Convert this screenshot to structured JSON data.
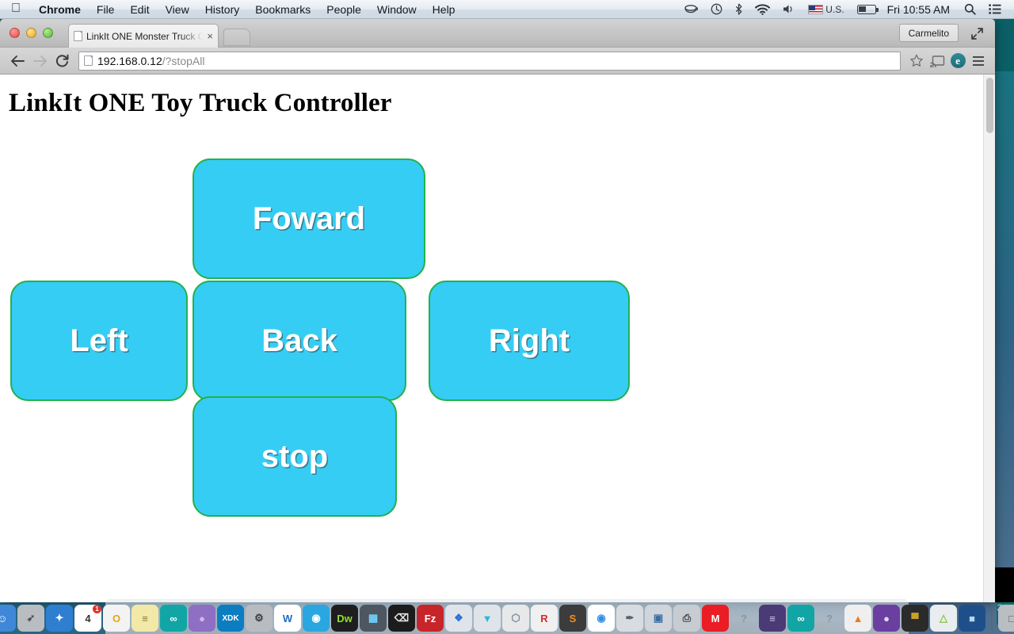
{
  "menubar": {
    "apple_icon": "apple-logo-icon",
    "items": [
      {
        "label": "Chrome",
        "bold": true
      },
      {
        "label": "File"
      },
      {
        "label": "Edit"
      },
      {
        "label": "View"
      },
      {
        "label": "History"
      },
      {
        "label": "Bookmarks"
      },
      {
        "label": "People"
      },
      {
        "label": "Window"
      },
      {
        "label": "Help"
      }
    ],
    "status": {
      "coffee_icon": "coffee-cup-icon",
      "timemachine_icon": "time-machine-icon",
      "bluetooth_icon": "bluetooth-icon",
      "wifi_icon": "wifi-icon",
      "volume_icon": "volume-icon",
      "input_source": "U.S.",
      "battery_icon": "battery-icon",
      "clock": "Fri 10:55 AM",
      "search_icon": "spotlight-search-icon",
      "notification_icon": "notification-center-icon"
    }
  },
  "window": {
    "tab": {
      "title": "LinkIt ONE Monster Truck C",
      "favicon": "page-icon",
      "close_label": "×"
    },
    "new_tab_label": "",
    "profile_label": "Carmelito",
    "fullscreen_icon": "fullscreen-arrows-icon"
  },
  "toolbar": {
    "back_icon": "back-arrow-icon",
    "forward_icon": "forward-arrow-icon",
    "reload_icon": "reload-icon",
    "url_host": "192.168.0.12",
    "url_path": "/?stopAll",
    "bookmark_icon": "star-icon",
    "cast_icon": "cast-icon",
    "extension_icon": "extension-e-icon",
    "extension_letter": "e",
    "menu_icon": "hamburger-menu-icon"
  },
  "page": {
    "heading": "LinkIt ONE Toy Truck Controller",
    "accent_fill": "#35cdf4",
    "accent_border": "#22b14c",
    "buttons": [
      {
        "id": "forward",
        "label": "Foward"
      },
      {
        "id": "left",
        "label": "Left"
      },
      {
        "id": "back",
        "label": "Back"
      },
      {
        "id": "right",
        "label": "Right"
      },
      {
        "id": "stop",
        "label": "stop"
      }
    ]
  },
  "dock": {
    "items": [
      {
        "name": "finder",
        "glyph": "☺",
        "bg": "#3f87d8",
        "fg": "#ffffff"
      },
      {
        "name": "launchpad",
        "glyph": "➶",
        "bg": "#b9bdc2",
        "fg": "#4a4f55"
      },
      {
        "name": "safari",
        "glyph": "✦",
        "bg": "#2f7fd0",
        "fg": "#ffffff"
      },
      {
        "name": "calendar",
        "glyph": "4",
        "bg": "#ffffff",
        "fg": "#333333",
        "badge": "1"
      },
      {
        "name": "office",
        "glyph": "O",
        "bg": "#f3f3f3",
        "fg": "#e8a317"
      },
      {
        "name": "stickies",
        "glyph": "≡",
        "bg": "#f2e8a8",
        "fg": "#8a7a35"
      },
      {
        "name": "arduino",
        "glyph": "∞",
        "bg": "#12a5a5",
        "fg": "#ffffff"
      },
      {
        "name": "purple-sphere",
        "glyph": "●",
        "bg": "#8e6fc4",
        "fg": "#cdb8ea"
      },
      {
        "name": "intel-xdk",
        "glyph": "XDK",
        "bg": "#0d7dc1",
        "fg": "#ffffff"
      },
      {
        "name": "system-preferences",
        "glyph": "⚙",
        "bg": "#b8bcc0",
        "fg": "#3b3f44"
      },
      {
        "name": "word",
        "glyph": "W",
        "bg": "#ffffff",
        "fg": "#1a6fc4"
      },
      {
        "name": "teal-app",
        "glyph": "◉",
        "bg": "#2aa7e0",
        "fg": "#ffffff"
      },
      {
        "name": "dreamweaver",
        "glyph": "Dw",
        "bg": "#1e1e1e",
        "fg": "#8fe02a"
      },
      {
        "name": "grabpro",
        "glyph": "▦",
        "bg": "#4e5661",
        "fg": "#6fd3ff"
      },
      {
        "name": "terminal",
        "glyph": "⌫",
        "bg": "#1c1c1c",
        "fg": "#e6e6e6"
      },
      {
        "name": "filezilla",
        "glyph": "Fz",
        "bg": "#c7252a",
        "fg": "#ffffff"
      },
      {
        "name": "blue-blocks",
        "glyph": "❖",
        "bg": "#dfe4ea",
        "fg": "#2b6fd0"
      },
      {
        "name": "teal-triangle",
        "glyph": "▼",
        "bg": "#dfe4ea",
        "fg": "#2ab9d9"
      },
      {
        "name": "3d-cube",
        "glyph": "⬡",
        "bg": "#e6e8ea",
        "fg": "#7d8a99"
      },
      {
        "name": "r-app",
        "glyph": "R",
        "bg": "#f0f0f0",
        "fg": "#d22b2b"
      },
      {
        "name": "sublime-text",
        "glyph": "S",
        "bg": "#3c3c3c",
        "fg": "#f09020"
      },
      {
        "name": "google-chrome",
        "glyph": "◉",
        "bg": "#ffffff",
        "fg": "#2f8de4"
      },
      {
        "name": "satellite",
        "glyph": "✒",
        "bg": "#d8dce0",
        "fg": "#55606b"
      },
      {
        "name": "remote-desktop",
        "glyph": "▣",
        "bg": "#cfd5da",
        "fg": "#3b6fa0"
      },
      {
        "name": "printer",
        "glyph": "⎙",
        "bg": "#c7ccd1",
        "fg": "#3f454b"
      },
      {
        "name": "makerbot",
        "glyph": "M",
        "bg": "#ea1c24",
        "fg": "#ffffff"
      },
      {
        "name": "unknown-app",
        "glyph": "?",
        "bg": "transparent",
        "fg": "#8d949b"
      },
      {
        "name": "purple-disc",
        "glyph": "≡",
        "bg": "#4a3a76",
        "fg": "#d7c9f0"
      },
      {
        "name": "arduino-ide",
        "glyph": "∞",
        "bg": "#12a5a5",
        "fg": "#ffffff"
      },
      {
        "name": "unknown-app-2",
        "glyph": "?",
        "bg": "transparent",
        "fg": "#8d949b"
      },
      {
        "name": "vlc",
        "glyph": "▲",
        "bg": "#efefef",
        "fg": "#ef7b17"
      },
      {
        "name": "github",
        "glyph": "●",
        "bg": "#6b3fa0",
        "fg": "#e3d6f5"
      },
      {
        "name": "serial-cable",
        "glyph": "▀",
        "bg": "#2b2b2b",
        "fg": "#c9a227"
      },
      {
        "name": "android",
        "glyph": "△",
        "bg": "#e9edf0",
        "fg": "#8bc34a"
      },
      {
        "name": "virtualbox",
        "glyph": "■",
        "bg": "#1f4f8b",
        "fg": "#b9d4ef"
      }
    ],
    "trash": {
      "name": "trash",
      "glyph": "ᴛ"
    }
  }
}
